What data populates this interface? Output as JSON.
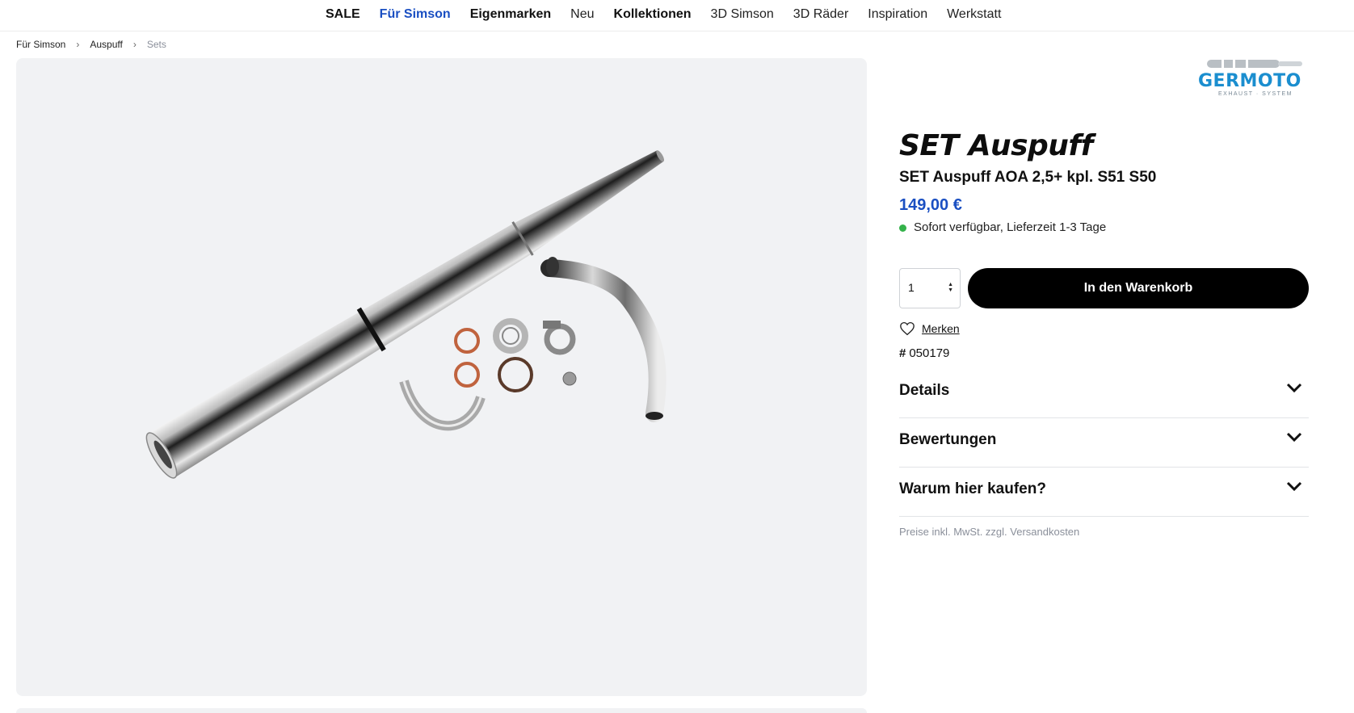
{
  "nav": {
    "items": [
      {
        "label": "SALE",
        "style": "bold"
      },
      {
        "label": "Für Simson",
        "style": "active"
      },
      {
        "label": "Eigenmarken",
        "style": "bold"
      },
      {
        "label": "Neu",
        "style": "normal"
      },
      {
        "label": "Kollektionen",
        "style": "bold"
      },
      {
        "label": "3D Simson",
        "style": "normal"
      },
      {
        "label": "3D Räder",
        "style": "normal"
      },
      {
        "label": "Inspiration",
        "style": "normal"
      },
      {
        "label": "Werkstatt",
        "style": "normal"
      }
    ]
  },
  "breadcrumb": {
    "items": [
      "Für Simson",
      "Auspuff",
      "Sets"
    ]
  },
  "brand": {
    "name": "GERMOTO",
    "tagline": "EXHAUST · SYSTEM",
    "color": "#1b8ecf"
  },
  "product": {
    "title": "SET Auspuff",
    "subtitle": "SET Auspuff AOA 2,5+ kpl. S51 S50",
    "price": "149,00 €",
    "price_color": "#1a4fc2",
    "availability": "Sofort verfügbar, Lieferzeit 1-3 Tage",
    "availability_color": "#34b24a",
    "quantity": "1",
    "add_to_cart": "In den Warenkorb",
    "wishlist": "Merken",
    "sku_symbol": "#",
    "sku": "050179"
  },
  "accordion": [
    {
      "label": "Details",
      "icon": "chevron-down-icon"
    },
    {
      "label": "Bewertungen",
      "icon": "chevron-down-icon"
    },
    {
      "label": "Warum hier kaufen?",
      "icon": "chevron-down-icon"
    }
  ],
  "price_note": "Preise inkl. MwSt. zzgl. Versandkosten"
}
